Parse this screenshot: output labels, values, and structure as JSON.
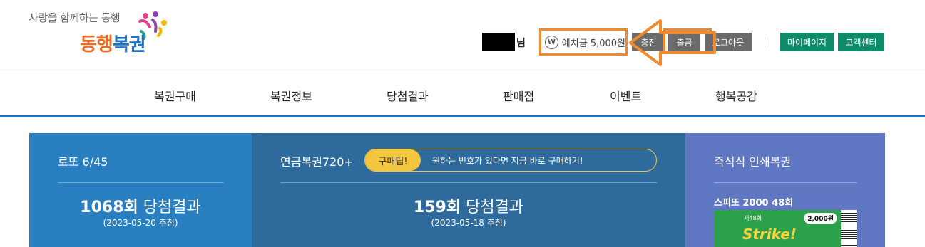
{
  "header": {
    "tagline": "사랑을 함께하는 동행",
    "logo_text_orange": "동행",
    "logo_text_blue": "복권",
    "user_suffix": "님",
    "deposit_icon": "W",
    "deposit_label": "예치금 5,000원",
    "charge_label": "충전",
    "withdraw_label": "출금",
    "logout_label": "로그아웃",
    "mypage_label": "마이페이지",
    "support_label": "고객센터"
  },
  "nav": {
    "items": [
      "복권구매",
      "복권정보",
      "당첨결과",
      "판매점",
      "이벤트",
      "행복공감"
    ]
  },
  "lotto": {
    "title": "로또 6/45",
    "round": "1068회",
    "result_label": " 당첨결과",
    "date": "(2023-05-20 추첨)"
  },
  "pension": {
    "title": "연금복권720+",
    "tip_badge": "구매팁!",
    "tip_text": "원하는 번호가 있다면 지금 바로 구매하기!",
    "round": "159회",
    "result_label": " 당첨결과",
    "date": "(2023-05-18 추첨)"
  },
  "instant": {
    "title": "즉석식 인쇄복권",
    "subtitle": "스피또 2000 48회",
    "ticket_no": "제48회",
    "ticket_price": "2,000원",
    "ticket_text": "Strike!"
  },
  "colors": {
    "accent_orange": "#f08a2c",
    "nav_blue": "#1a73c6",
    "green_button": "#0f8a6a",
    "lotto_panel": "#2a7fc0",
    "pension_panel": "#2e6b9c",
    "instant_panel": "#6078c4"
  }
}
